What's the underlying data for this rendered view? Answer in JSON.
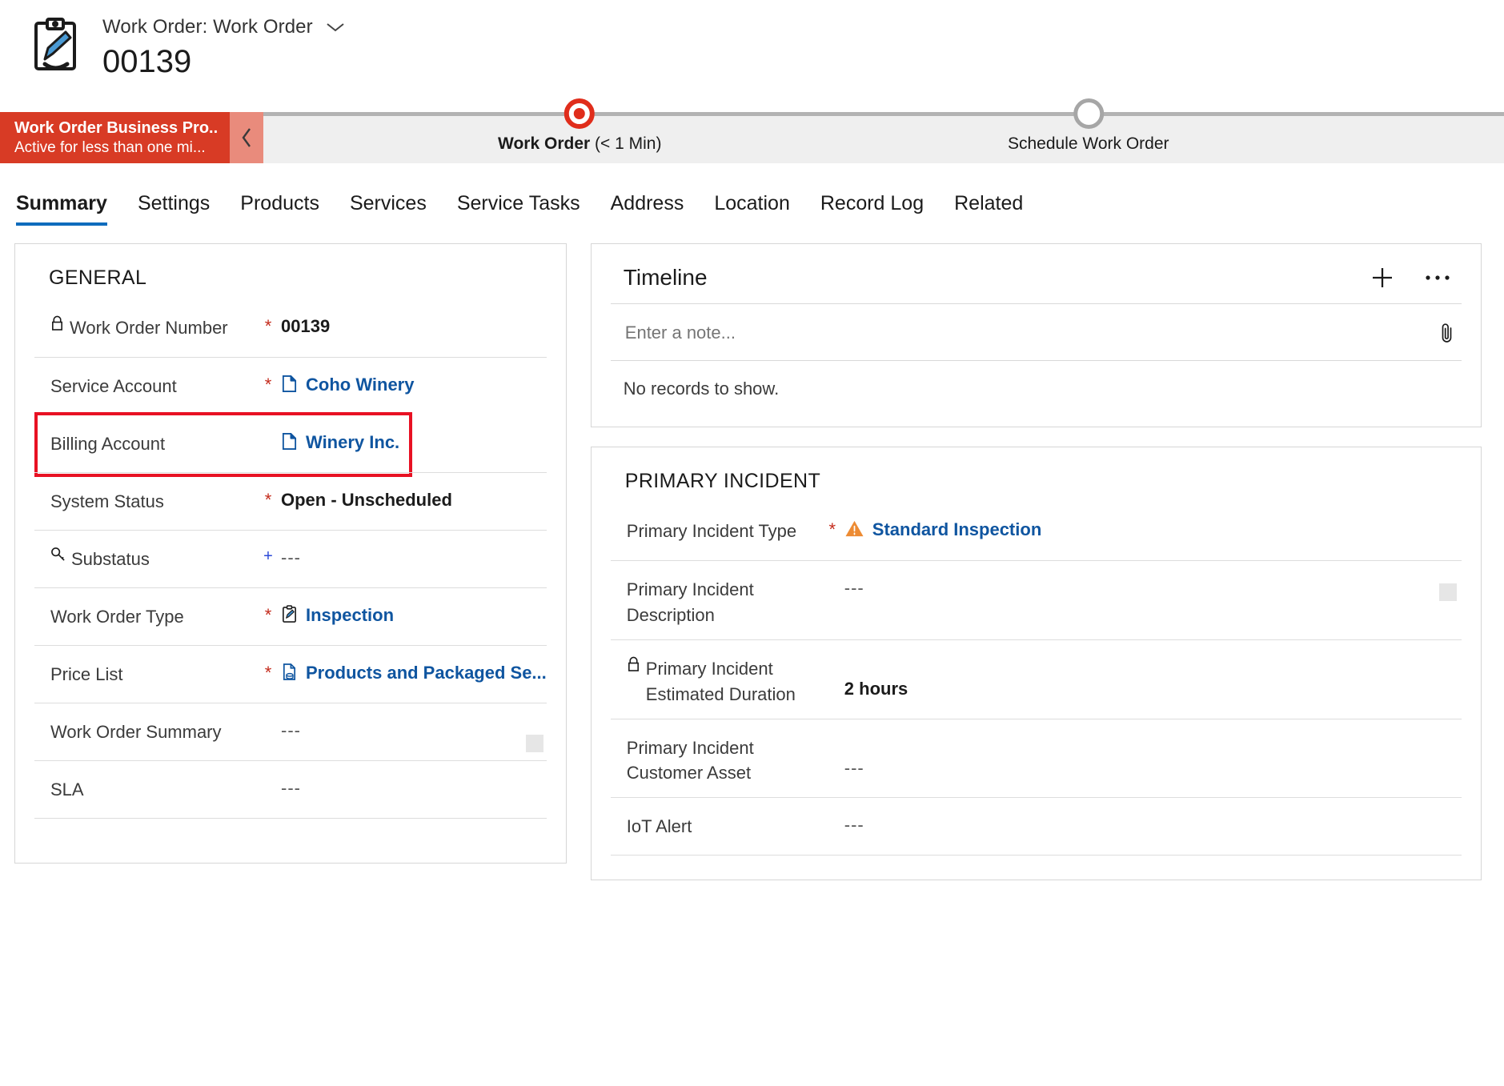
{
  "header": {
    "icon": "work-order-clipboard-icon",
    "entity_label": "Work Order: Work Order",
    "record_name": "00139",
    "dropdown_icon": "chevron-down-icon"
  },
  "business_process": {
    "name": "Work Order Business Pro...",
    "status": "Active for less than one mi...",
    "collapse_icon": "chevron-left-icon",
    "header_color": "#d83b25",
    "stages": [
      {
        "label": "Work Order",
        "duration": "(< 1 Min)",
        "active": true
      },
      {
        "label": "Schedule Work Order",
        "duration": "",
        "active": false
      }
    ]
  },
  "tabs": [
    {
      "label": "Summary",
      "selected": true
    },
    {
      "label": "Settings",
      "selected": false
    },
    {
      "label": "Products",
      "selected": false
    },
    {
      "label": "Services",
      "selected": false
    },
    {
      "label": "Service Tasks",
      "selected": false
    },
    {
      "label": "Address",
      "selected": false
    },
    {
      "label": "Location",
      "selected": false
    },
    {
      "label": "Record Log",
      "selected": false
    },
    {
      "label": "Related",
      "selected": false
    }
  ],
  "general": {
    "title": "GENERAL",
    "fields": [
      {
        "label": "Work Order Number",
        "required": "*",
        "value": "00139",
        "lock": true,
        "bold": true
      },
      {
        "label": "Service Account",
        "required": "*",
        "value": "Coho Winery",
        "link": true,
        "icon": "account-record-icon"
      },
      {
        "label": "Billing Account",
        "required": "",
        "value": "Winery Inc.",
        "link": true,
        "icon": "account-record-icon",
        "highlighted": true
      },
      {
        "label": "System Status",
        "required": "*",
        "value": "Open - Unscheduled",
        "bold": true
      },
      {
        "label": "Substatus",
        "required": "+",
        "value": "---",
        "key": true
      },
      {
        "label": "Work Order Type",
        "required": "*",
        "value": "Inspection",
        "link": true,
        "icon": "work-order-type-icon"
      },
      {
        "label": "Price List",
        "required": "*",
        "value": "Products and Packaged Se...",
        "link": true,
        "icon": "price-list-icon"
      },
      {
        "label": "Work Order Summary",
        "required": "",
        "value": "---",
        "grip": true
      },
      {
        "label": "SLA",
        "required": "",
        "value": "---"
      }
    ]
  },
  "timeline": {
    "title": "Timeline",
    "add_icon": "plus-icon",
    "more_icon": "ellipsis-icon",
    "attach_icon": "paperclip-icon",
    "note_placeholder": "Enter a note...",
    "empty_text": "No records to show."
  },
  "primary_incident": {
    "title": "PRIMARY INCIDENT",
    "fields": [
      {
        "label": "Primary Incident Type",
        "required": "*",
        "value": "Standard Inspection",
        "link": true,
        "icon": "incident-warning-icon"
      },
      {
        "label": "Primary Incident Description",
        "required": "",
        "value": "---",
        "grip": true
      },
      {
        "label": "Primary Incident Estimated Duration",
        "required": "",
        "value": "2 hours",
        "lock": true,
        "bold": true
      },
      {
        "label": "Primary Incident Customer Asset",
        "required": "",
        "value": "---"
      },
      {
        "label": "IoT Alert",
        "required": "",
        "value": "---"
      }
    ]
  },
  "colors": {
    "link": "#0f55a0",
    "required": "#c42b1c",
    "accent": "#0f6cbd",
    "highlight_box": "#e81123",
    "bpf_active": "#e02d1b"
  }
}
